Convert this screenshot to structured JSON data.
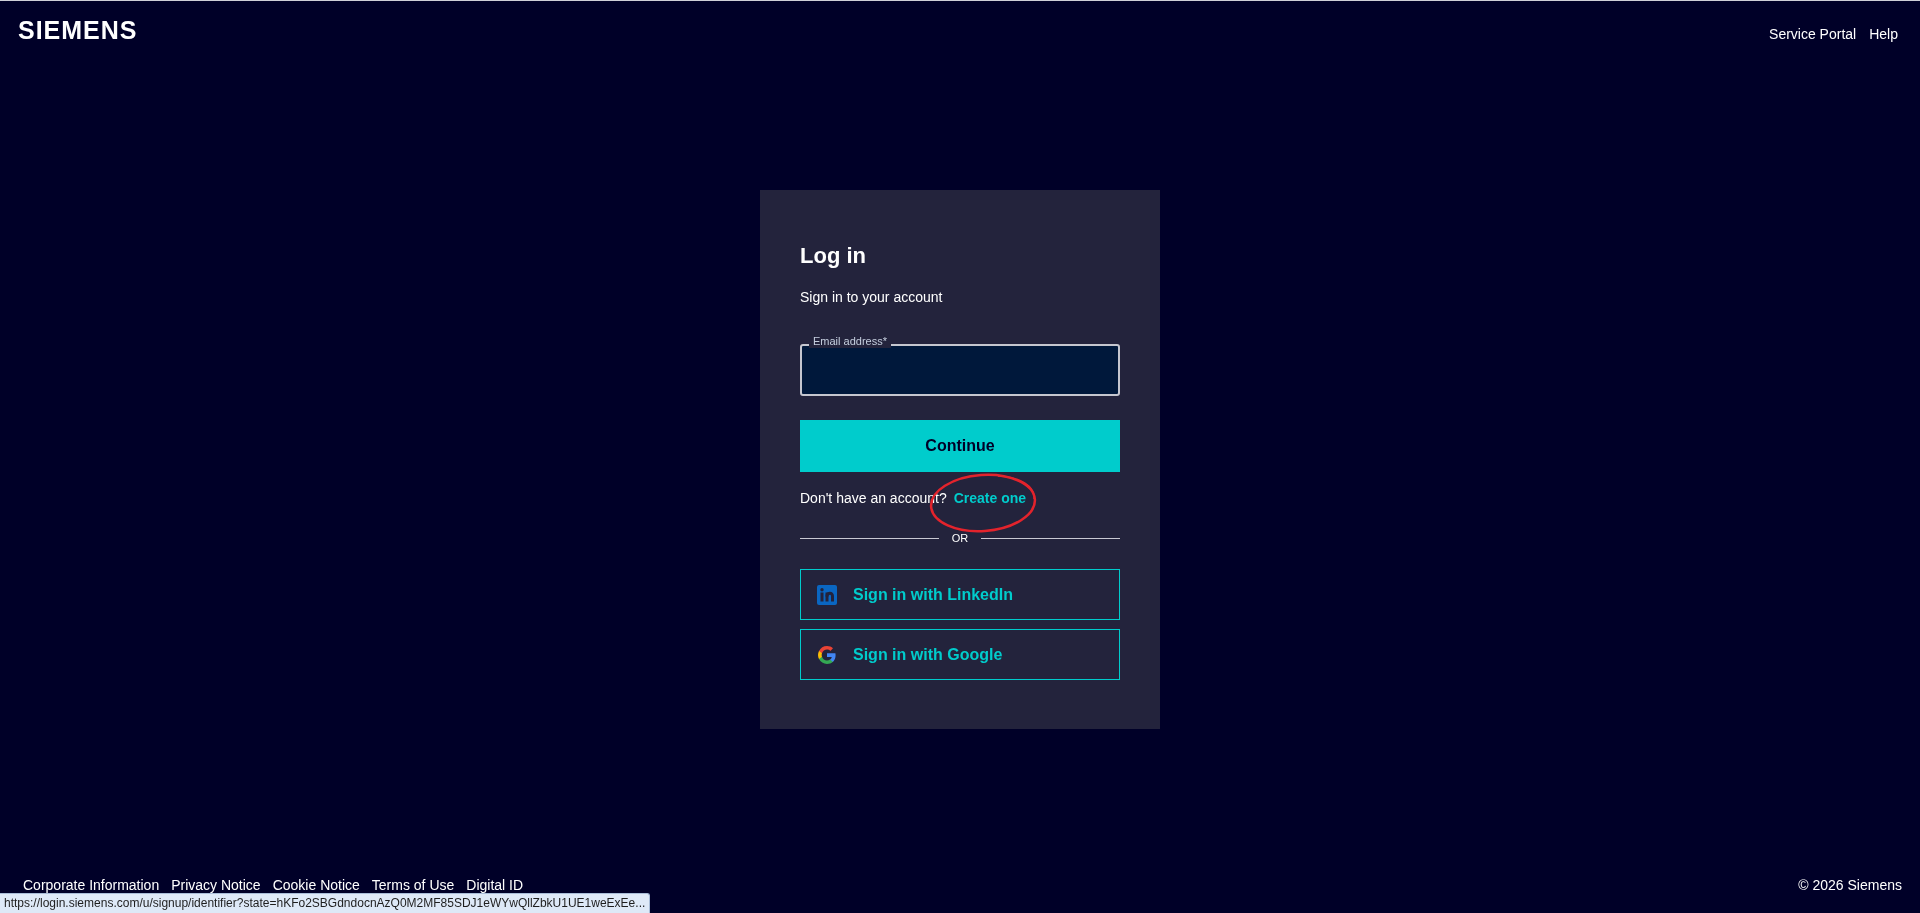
{
  "header": {
    "logo": "SIEMENS",
    "links": [
      "Service Portal",
      "Help"
    ]
  },
  "login_card": {
    "title": "Log in",
    "subtitle": "Sign in to your account",
    "email_field": {
      "label": "Email address*"
    },
    "continue_button": "Continue",
    "signup_prompt": {
      "text": "Don't have an account?",
      "link": "Create one"
    },
    "divider": "OR",
    "social_buttons": [
      {
        "kind": "linkedin",
        "label": "Sign in with LinkedIn"
      },
      {
        "kind": "google",
        "label": "Sign in with Google"
      }
    ]
  },
  "footer": {
    "links": [
      "Corporate Information",
      "Privacy Notice",
      "Cookie Notice",
      "Terms of Use",
      "Digital ID"
    ],
    "copyright": "© 2026 Siemens"
  },
  "status_bar": {
    "url": "https://login.siemens.com/u/signup/identifier?state=hKFo2SBGdndocnAzQ0M2MF85SDJ1eWYwQllZbkU1UE1weExEe..."
  }
}
